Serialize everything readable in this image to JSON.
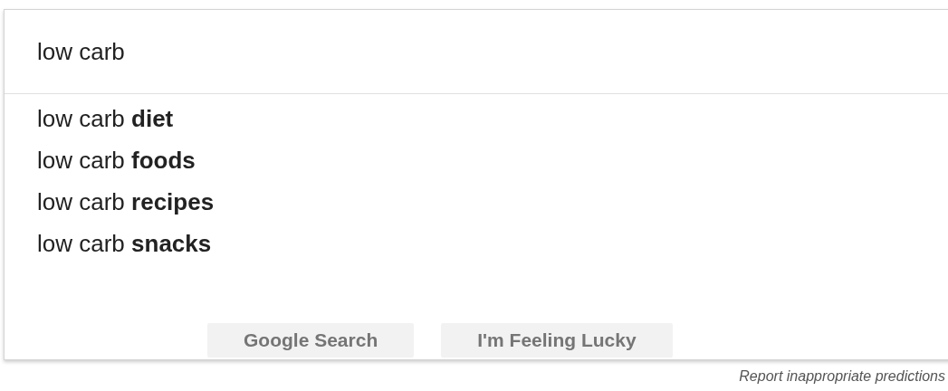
{
  "search": {
    "value": "low carb"
  },
  "suggestions": [
    "low carb **diet**",
    "low carb **foods**",
    "low carb **recipes**",
    "low carb **snacks**"
  ],
  "buttons": [
    "Google Search",
    "I'm Feeling Lucky"
  ],
  "report_link": "Report inappropriate predictions"
}
